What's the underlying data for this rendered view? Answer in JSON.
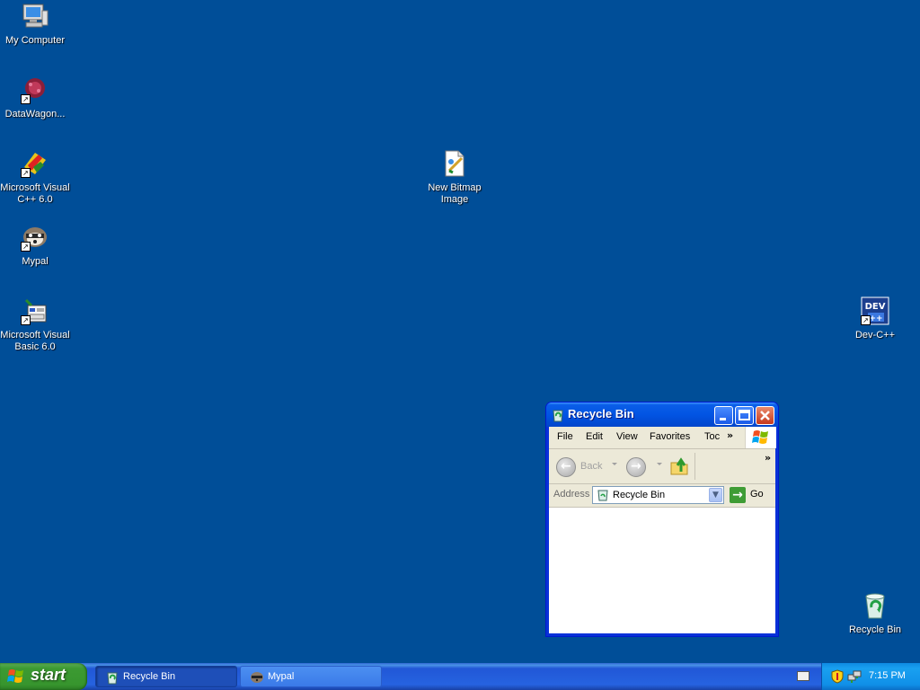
{
  "desktop": {
    "icons": [
      {
        "label": "My Computer"
      },
      {
        "label": "DataWagon..."
      },
      {
        "label_line1": "Microsoft Visual",
        "label_line2": "C++ 6.0"
      },
      {
        "label": "Mypal"
      },
      {
        "label_line1": "Microsoft Visual",
        "label_line2": "Basic 6.0"
      },
      {
        "label_line1": "New Bitmap",
        "label_line2": "Image"
      },
      {
        "label": "Dev-C++",
        "badge": "DEV"
      },
      {
        "label": "Recycle Bin"
      }
    ]
  },
  "window": {
    "title": "Recycle Bin",
    "menu": [
      "File",
      "Edit",
      "View",
      "Favorites",
      "Toc"
    ],
    "menu_more": "»",
    "toolbar": {
      "back_label": "Back",
      "more": "»"
    },
    "address": {
      "label": "Address",
      "value": "Recycle Bin",
      "go_label": "Go"
    }
  },
  "taskbar": {
    "start_label": "start",
    "tasks": [
      {
        "label": "Recycle Bin",
        "active": true
      },
      {
        "label": "Mypal",
        "active": false
      }
    ],
    "clock": "7:15 PM"
  },
  "colors": {
    "desktop": "#004e98",
    "titlebar": "#0254e3",
    "start": "#3c9a32",
    "taskbar": "#2663e0",
    "tray": "#1090e8"
  }
}
